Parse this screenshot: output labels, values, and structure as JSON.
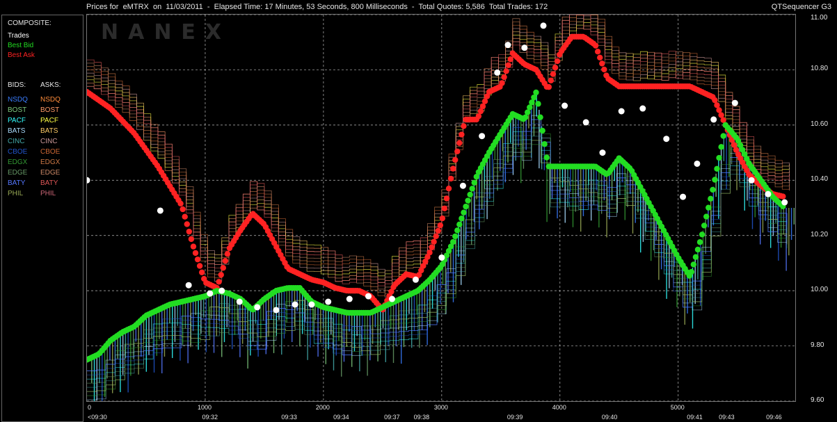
{
  "titlebar": {
    "text": "Prices for  eMTRX  on  11/03/2011  -  Elapsed Time: 17 Minutes, 53 Seconds, 800 Milliseconds  -  Total Quotes: 5,586  Total Trades: 172",
    "product": "QTSequencer G3"
  },
  "watermark": "NANEX",
  "legend": {
    "composite_header": "COMPOSITE:",
    "composite": [
      {
        "label": "Trades",
        "color": "#ffffff"
      },
      {
        "label": "Best Bid",
        "color": "#22dd22"
      },
      {
        "label": "Best Ask",
        "color": "#ff2222"
      }
    ],
    "bids_header": "BIDS:",
    "asks_header": "ASKS:",
    "exchanges": [
      {
        "bid": "NSDQ",
        "ask": "NSDQ",
        "bid_color": "#3a7dff",
        "ask_color": "#ff8c3a"
      },
      {
        "bid": "BOST",
        "ask": "BOST",
        "bid_color": "#7ec97e",
        "ask_color": "#ff9966"
      },
      {
        "bid": "PACF",
        "ask": "PACF",
        "bid_color": "#33ffff",
        "ask_color": "#ffff44"
      },
      {
        "bid": "BATS",
        "ask": "BATS",
        "bid_color": "#aaddff",
        "ask_color": "#ffcc66"
      },
      {
        "bid": "CINC",
        "ask": "CINC",
        "bid_color": "#44aaaa",
        "ask_color": "#cc9999"
      },
      {
        "bid": "CBOE",
        "ask": "CBOE",
        "bid_color": "#2255cc",
        "ask_color": "#cc6633"
      },
      {
        "bid": "EDGX",
        "ask": "EDGX",
        "bid_color": "#339933",
        "ask_color": "#cc7744"
      },
      {
        "bid": "EDGE",
        "ask": "EDGE",
        "bid_color": "#669966",
        "ask_color": "#cc8866"
      },
      {
        "bid": "BATY",
        "ask": "BATY",
        "bid_color": "#5577ff",
        "ask_color": "#dd5555"
      },
      {
        "bid": "PHIL",
        "ask": "PHIL",
        "bid_color": "#99aa55",
        "ask_color": "#cc6677"
      }
    ]
  },
  "chart_data": {
    "type": "scatter",
    "ylim": [
      9.6,
      11.0
    ],
    "y_ticks": [
      "11.00",
      "10.80",
      "10.60",
      "10.40",
      "10.20",
      "10.00",
      "9.80",
      "9.60"
    ],
    "y_tick_values": [
      11.0,
      10.8,
      10.6,
      10.4,
      10.2,
      10.0,
      9.8,
      9.6
    ],
    "xlim": [
      0,
      5990
    ],
    "x_ticks": [
      "0",
      "1000",
      "2000",
      "3000",
      "4000",
      "5000"
    ],
    "x_tick_values": [
      0,
      1000,
      2000,
      3000,
      4000,
      5000
    ],
    "time_labels": [
      {
        "label": "<09:30",
        "x": 0
      },
      {
        "label": "09:32",
        "x": 1050
      },
      {
        "label": "09:33",
        "x": 1720
      },
      {
        "label": "09:34",
        "x": 2160
      },
      {
        "label": "09:37",
        "x": 2590
      },
      {
        "label": "09:38",
        "x": 2840
      },
      {
        "label": "09:39",
        "x": 3630
      },
      {
        "label": "09:40",
        "x": 4430
      },
      {
        "label": "09:41",
        "x": 5150
      },
      {
        "label": "09:43",
        "x": 5420
      },
      {
        "label": "09:46",
        "x": 5820
      }
    ],
    "grid": true,
    "series": [
      {
        "name": "Best Ask",
        "color": "#ff2222",
        "x": [
          0,
          200,
          400,
          600,
          800,
          900,
          1000,
          1100,
          1200,
          1300,
          1400,
          1500,
          1600,
          1700,
          1800,
          1900,
          2000,
          2100,
          2200,
          2300,
          2400,
          2500,
          2600,
          2700,
          2800,
          2900,
          3000,
          3100,
          3200,
          3300,
          3400,
          3500,
          3600,
          3700,
          3800,
          3900,
          4000,
          4100,
          4200,
          4300,
          4400,
          4500,
          4600,
          4700,
          4800,
          4900,
          5000,
          5100,
          5200,
          5300,
          5400,
          5500,
          5600,
          5700,
          5800,
          5900
        ],
        "y": [
          10.72,
          10.66,
          10.57,
          10.45,
          10.31,
          10.16,
          10.03,
          10.01,
          10.15,
          10.22,
          10.28,
          10.24,
          10.16,
          10.08,
          10.06,
          10.04,
          10.03,
          10.01,
          10.0,
          10.0,
          9.98,
          9.93,
          10.02,
          10.06,
          10.05,
          10.14,
          10.25,
          10.45,
          10.62,
          10.62,
          10.72,
          10.74,
          10.86,
          10.82,
          10.8,
          10.73,
          10.86,
          10.92,
          10.92,
          10.89,
          10.77,
          10.74,
          10.74,
          10.74,
          10.74,
          10.74,
          10.74,
          10.74,
          10.72,
          10.7,
          10.6,
          10.5,
          10.42,
          10.38,
          10.35,
          10.34
        ]
      },
      {
        "name": "Best Bid",
        "color": "#22dd22",
        "x": [
          0,
          100,
          200,
          300,
          400,
          500,
          600,
          700,
          800,
          900,
          1000,
          1100,
          1200,
          1300,
          1400,
          1500,
          1600,
          1700,
          1800,
          1900,
          2000,
          2100,
          2200,
          2300,
          2400,
          2500,
          2600,
          2700,
          2800,
          2900,
          3000,
          3100,
          3200,
          3300,
          3400,
          3500,
          3600,
          3700,
          3800,
          3900,
          4000,
          4100,
          4200,
          4300,
          4400,
          4500,
          4600,
          4700,
          4800,
          4900,
          5000,
          5100,
          5200,
          5300,
          5400,
          5500,
          5600,
          5700,
          5800,
          5900
        ],
        "y": [
          9.75,
          9.77,
          9.82,
          9.85,
          9.87,
          9.91,
          9.93,
          9.95,
          9.96,
          9.97,
          9.98,
          10.0,
          9.99,
          9.97,
          9.93,
          9.97,
          10.0,
          10.01,
          10.01,
          9.96,
          9.94,
          9.93,
          9.92,
          9.92,
          9.92,
          9.94,
          9.96,
          9.98,
          10.0,
          10.04,
          10.09,
          10.18,
          10.3,
          10.42,
          10.5,
          10.57,
          10.64,
          10.62,
          10.72,
          10.45,
          10.45,
          10.45,
          10.45,
          10.45,
          10.42,
          10.48,
          10.44,
          10.36,
          10.28,
          10.2,
          10.12,
          10.05,
          10.2,
          10.38,
          10.6,
          10.55,
          10.46,
          10.4,
          10.34,
          10.3
        ]
      },
      {
        "name": "Trades",
        "color": "#ffffff",
        "x": [
          0,
          620,
          860,
          1040,
          1140,
          1290,
          1440,
          1600,
          1760,
          1900,
          2040,
          2220,
          2380,
          2580,
          2780,
          3000,
          3180,
          3340,
          3470,
          3560,
          3700,
          3860,
          4040,
          4220,
          4360,
          4520,
          4700,
          4900,
          5040,
          5160,
          5300,
          5480,
          5620,
          5760,
          5900
        ],
        "y": [
          10.4,
          10.29,
          10.02,
          9.99,
          10.0,
          9.96,
          9.94,
          9.93,
          9.95,
          9.95,
          9.96,
          9.97,
          9.98,
          9.97,
          10.04,
          10.12,
          10.38,
          10.56,
          10.79,
          10.89,
          10.88,
          10.96,
          10.67,
          10.61,
          10.5,
          10.65,
          10.66,
          10.55,
          10.34,
          10.46,
          10.62,
          10.68,
          10.4,
          10.35,
          10.32
        ]
      }
    ]
  }
}
